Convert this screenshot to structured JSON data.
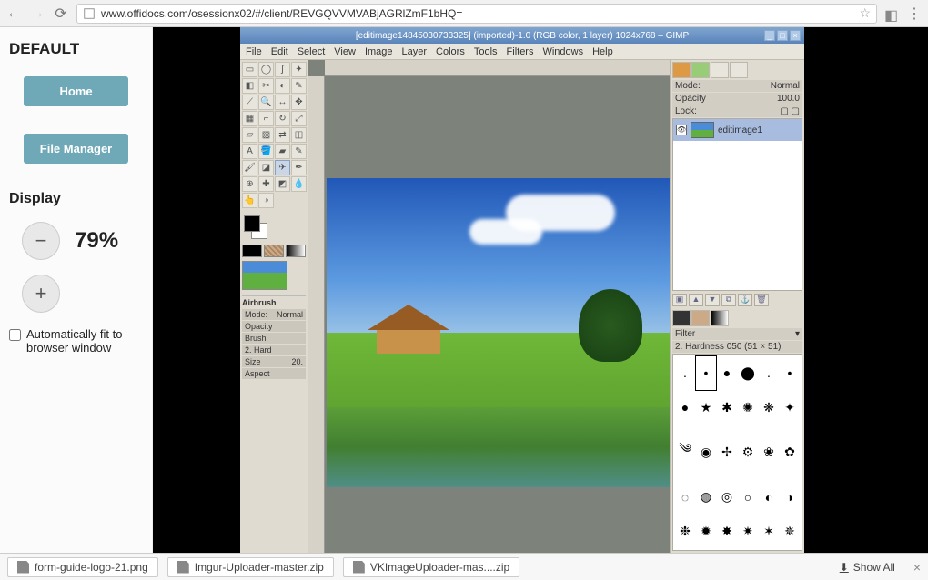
{
  "browser": {
    "url": "www.offidocs.com/osessionx02/#/client/REVGQVVMVABjAGRlZmF1bHQ=",
    "star": "☆"
  },
  "sidebar": {
    "title": "DEFAULT",
    "home": "Home",
    "file_manager": "File Manager",
    "display": "Display",
    "zoom": "79%",
    "autofit": "Automatically fit to browser window"
  },
  "gimp": {
    "title": "[editimage14845030733325] (imported)-1.0 (RGB color, 1 layer) 1024x768 – GIMP",
    "menu": [
      "File",
      "Edit",
      "Select",
      "View",
      "Image",
      "Layer",
      "Colors",
      "Tools",
      "Filters",
      "Windows",
      "Help"
    ],
    "tool_opts": {
      "name": "Airbrush",
      "mode_lbl": "Mode:",
      "mode_val": "Normal",
      "opacity_lbl": "Opacity",
      "brush_lbl": "Brush",
      "brush_val": "2. Hard",
      "size_lbl": "Size",
      "size_val": "20.",
      "aspect_lbl": "Aspect"
    },
    "right": {
      "mode_lbl": "Mode:",
      "mode_val": "Normal",
      "opacity_lbl": "Opacity",
      "opacity_val": "100.0",
      "lock_lbl": "Lock:",
      "layer_name": "editimage1",
      "filter_lbl": "Filter",
      "brush_info": "2. Hardness 050 (51 × 51)"
    }
  },
  "downloads": {
    "items": [
      "form-guide-logo-21.png",
      "Imgur-Uploader-master.zip",
      "VKImageUploader-mas....zip"
    ],
    "show_all": "Show All"
  }
}
